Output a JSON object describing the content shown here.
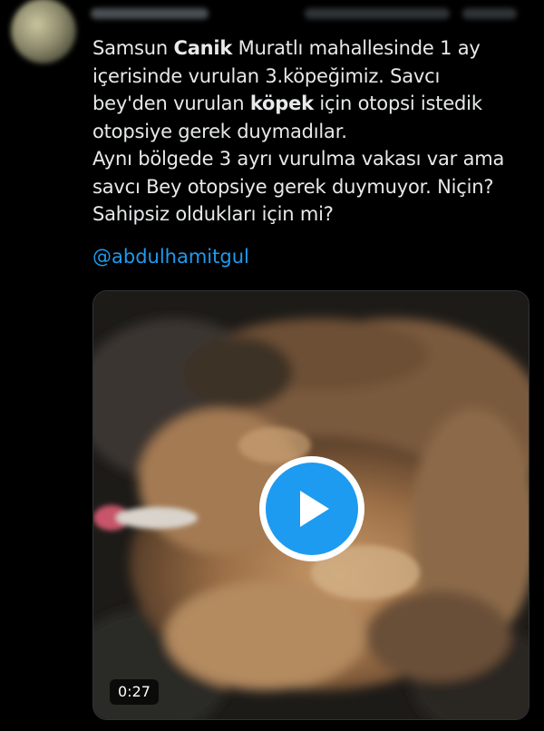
{
  "tweet": {
    "line1_a": "Samsun ",
    "line1_b": "Canik",
    "line1_c": " Muratlı mahallesinde 1 ay",
    "line2": "içerisinde vurulan 3.köpeğimiz. Savcı",
    "line3_a": "bey'den vurulan ",
    "line3_b": "köpek",
    "line3_c": " için otopsi istedik",
    "line4": "otopsiye gerek duymadılar.",
    "line5": "Aynı bölgede 3 ayrı vurulma vakası var ama",
    "line6": "savcı Bey otopsiye gerek duymuyor. Niçin?",
    "line7": "Sahipsiz oldukları için mi?",
    "mention": "@abdulhamitgul"
  },
  "video": {
    "duration": "0:27",
    "play_icon": "play-icon"
  },
  "colors": {
    "background": "#000000",
    "text": "#e7e9ea",
    "link": "#1d9bf0",
    "play_button": "#1d9bf0"
  }
}
